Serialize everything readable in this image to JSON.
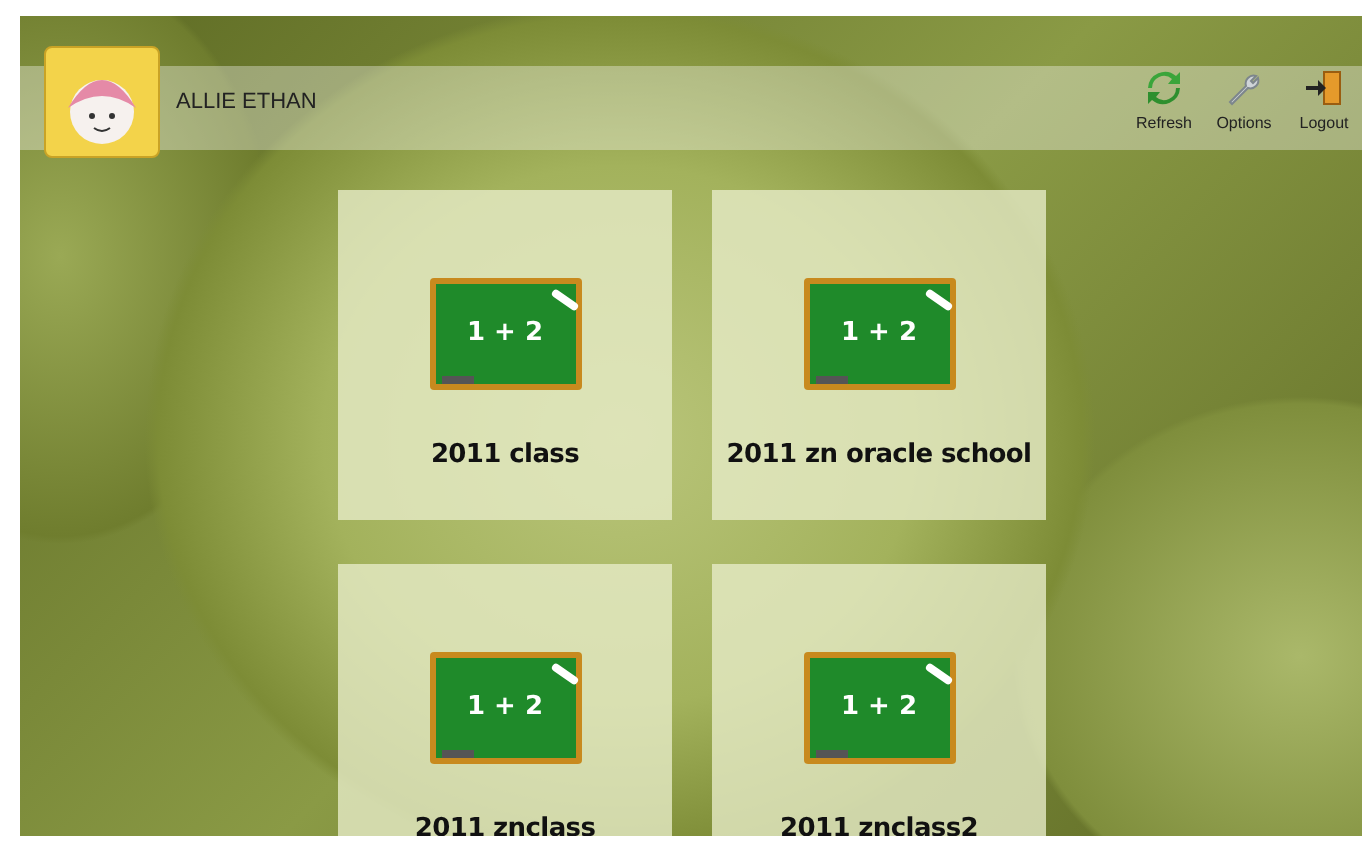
{
  "user": {
    "name": "ALLIE ETHAN"
  },
  "toolbar": [
    {
      "kind": "refresh",
      "label": "Refresh"
    },
    {
      "kind": "options",
      "label": "Options"
    },
    {
      "kind": "logout",
      "label": "Logout"
    }
  ],
  "classes": [
    {
      "name": "2011 class",
      "board_text": "1 + 2"
    },
    {
      "name": "2011 zn oracle school",
      "board_text": "1 + 2"
    },
    {
      "name": "2011 znclass",
      "board_text": "1 + 2"
    },
    {
      "name": "2011 znclass2",
      "board_text": "1 + 2"
    }
  ]
}
